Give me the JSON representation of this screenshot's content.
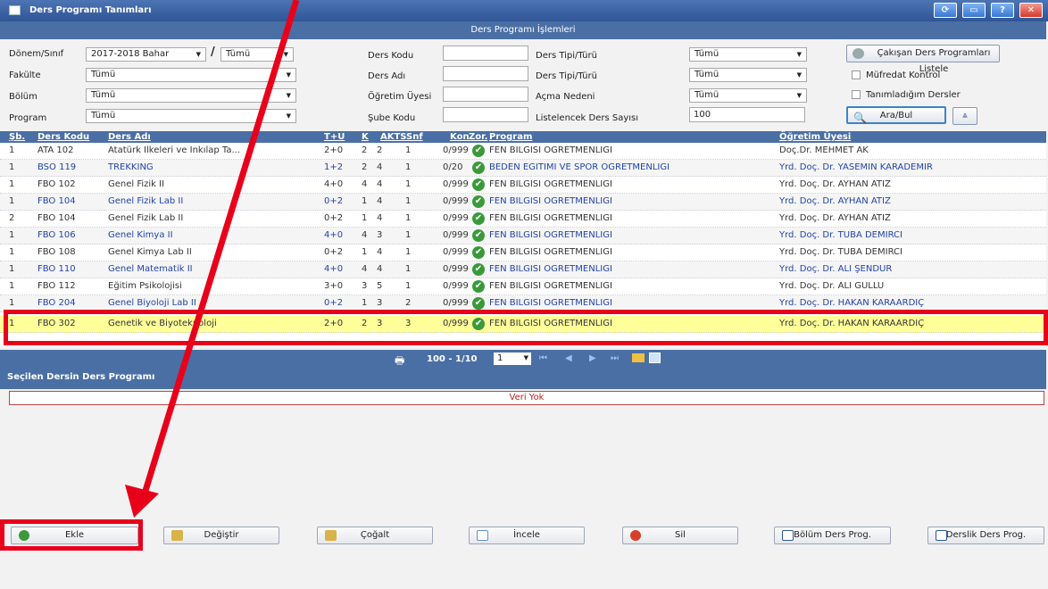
{
  "window": {
    "title": "Ders Programı Tanımları"
  },
  "section_title": "Ders Programı İşlemleri",
  "filters": {
    "donem_label": "Dönem/Sınıf",
    "donem_value": "2017-2018 Bahar",
    "donem_sep": "/",
    "sinif_value": "Tümü",
    "fakulte_label": "Fakülte",
    "fakulte_value": "Tümü",
    "bolum_label": "Bölüm",
    "bolum_value": "Tümü",
    "program_label": "Program",
    "program_value": "Tümü",
    "ders_kodu_label": "Ders Kodu",
    "ders_adi_label": "Ders Adı",
    "ogretim_label": "Öğretim Üyesi",
    "sube_label": "Şube Kodu",
    "tip1_label": "Ders Tipi/Türü",
    "tip1_value": "Tümü",
    "tip2_label": "Ders Tipi/Türü",
    "tip2_value": "Tümü",
    "acma_label": "Açma Nedeni",
    "acma_value": "Tümü",
    "liste_label": "Listelencek Ders Sayısı",
    "liste_value": "100",
    "cakisan_button": "Çakışan Ders Programları Listele",
    "mufredat_label": "Müfredat Kontrol",
    "tanimladigim_label": "Tanımladığım Dersler",
    "ara_button": "Ara/Bul"
  },
  "table": {
    "headers": {
      "sb": "Şb.",
      "kod": "Ders Kodu",
      "adi": "Ders Adı",
      "tu": "T+U",
      "k": "K",
      "akts": "AKTS",
      "snf": "Snf",
      "kon": "Kon",
      "zor": "Zor.",
      "program": "Program",
      "ogretim": "Öğretim Üyesi"
    },
    "rows": [
      {
        "sb": "1",
        "kod": "ATA 102",
        "adi": "Atatürk İlkeleri ve İnkılap Ta...",
        "tu": "2+0",
        "k": "2",
        "akts": "2",
        "snf": "1",
        "kon": "0/999",
        "program": "FEN BİLGİSİ ÖĞRETMENLİĞİ",
        "ogretim": "Doç.Dr. MEHMET AK",
        "link": false
      },
      {
        "sb": "1",
        "kod": "BSO 119",
        "adi": "TREKKİNG",
        "tu": "1+2",
        "k": "2",
        "akts": "4",
        "snf": "1",
        "kon": "0/20",
        "program": "BEDEN EĞİTİMİ VE SPOR ÖĞRETMENLİĞİ",
        "ogretim": "Yrd. Doç. Dr. YASEMİN KARADEMİR",
        "link": true
      },
      {
        "sb": "1",
        "kod": "FBÖ 102",
        "adi": "Genel Fizik II",
        "tu": "4+0",
        "k": "4",
        "akts": "4",
        "snf": "1",
        "kon": "0/999",
        "program": "FEN BİLGİSİ ÖĞRETMENLİĞİ",
        "ogretim": "Yrd. Doç. Dr. AYHAN ATIZ",
        "link": false
      },
      {
        "sb": "1",
        "kod": "FBÖ 104",
        "adi": "Genel Fizik Lab II",
        "tu": "0+2",
        "k": "1",
        "akts": "4",
        "snf": "1",
        "kon": "0/999",
        "program": "FEN BİLGİSİ ÖĞRETMENLİĞİ",
        "ogretim": "Yrd. Doç. Dr. AYHAN ATIZ",
        "link": true
      },
      {
        "sb": "2",
        "kod": "FBÖ 104",
        "adi": "Genel Fizik Lab II",
        "tu": "0+2",
        "k": "1",
        "akts": "4",
        "snf": "1",
        "kon": "0/999",
        "program": "FEN BİLGİSİ ÖĞRETMENLİĞİ",
        "ogretim": "Yrd. Doç. Dr. AYHAN ATIZ",
        "link": false
      },
      {
        "sb": "1",
        "kod": "FBÖ 106",
        "adi": "Genel Kimya II",
        "tu": "4+0",
        "k": "4",
        "akts": "3",
        "snf": "1",
        "kon": "0/999",
        "program": "FEN BİLGİSİ ÖĞRETMENLİĞİ",
        "ogretim": "Yrd. Doç. Dr. TUBA DEMİRCİ",
        "link": true
      },
      {
        "sb": "1",
        "kod": "FBÖ 108",
        "adi": "Genel Kimya Lab II",
        "tu": "0+2",
        "k": "1",
        "akts": "4",
        "snf": "1",
        "kon": "0/999",
        "program": "FEN BİLGİSİ ÖĞRETMENLİĞİ",
        "ogretim": "Yrd. Doç. Dr. TUBA DEMİRCİ",
        "link": false
      },
      {
        "sb": "1",
        "kod": "FBÖ 110",
        "adi": "Genel Matematik II",
        "tu": "4+0",
        "k": "4",
        "akts": "4",
        "snf": "1",
        "kon": "0/999",
        "program": "FEN BİLGİSİ ÖĞRETMENLİĞİ",
        "ogretim": "Yrd. Doç. Dr. ALİ ŞENDUR",
        "link": true
      },
      {
        "sb": "1",
        "kod": "FBÖ 112",
        "adi": "Eğitim Psikolojisi",
        "tu": "3+0",
        "k": "3",
        "akts": "5",
        "snf": "1",
        "kon": "0/999",
        "program": "FEN BİLGİSİ ÖĞRETMENLİĞİ",
        "ogretim": "Yrd. Doç. Dr. ALİ GÜLLÜ",
        "link": false
      },
      {
        "sb": "1",
        "kod": "FBÖ 204",
        "adi": "Genel Biyoloji Lab II",
        "tu": "0+2",
        "k": "1",
        "akts": "3",
        "snf": "2",
        "kon": "0/999",
        "program": "FEN BİLGİSİ ÖĞRETMENLİĞİ",
        "ogretim": "Yrd. Doç. Dr. HAKAN KARAARDIÇ",
        "link": true
      },
      {
        "sb": "1",
        "kod": "FBÖ 302",
        "adi": "Genetik ve Biyoteknoloji",
        "tu": "2+0",
        "k": "2",
        "akts": "3",
        "snf": "3",
        "kon": "0/999",
        "program": "FEN BİLGİSİ ÖĞRETMENLİĞİ",
        "ogretim": "Yrd. Doç. Dr. HAKAN KARAARDIÇ",
        "link": false,
        "selected": true
      }
    ]
  },
  "pager": {
    "count": "100 - 1/10",
    "page": "1"
  },
  "selected_section_title": "Seçilen Dersin Ders Programı",
  "empty_text": "Veri Yok",
  "actions": {
    "ekle": "Ekle",
    "degistir": "Değiştir",
    "cogalt": "Çoğalt",
    "incele": "İncele",
    "sil": "Sil",
    "bolum": "Bölüm Ders Prog.",
    "derslik": "Derslik Ders Prog."
  },
  "colors": {
    "header_blue": "#4a6fa5",
    "highlight_yellow": "#ffff99",
    "annotation_red": "#e8001b"
  }
}
